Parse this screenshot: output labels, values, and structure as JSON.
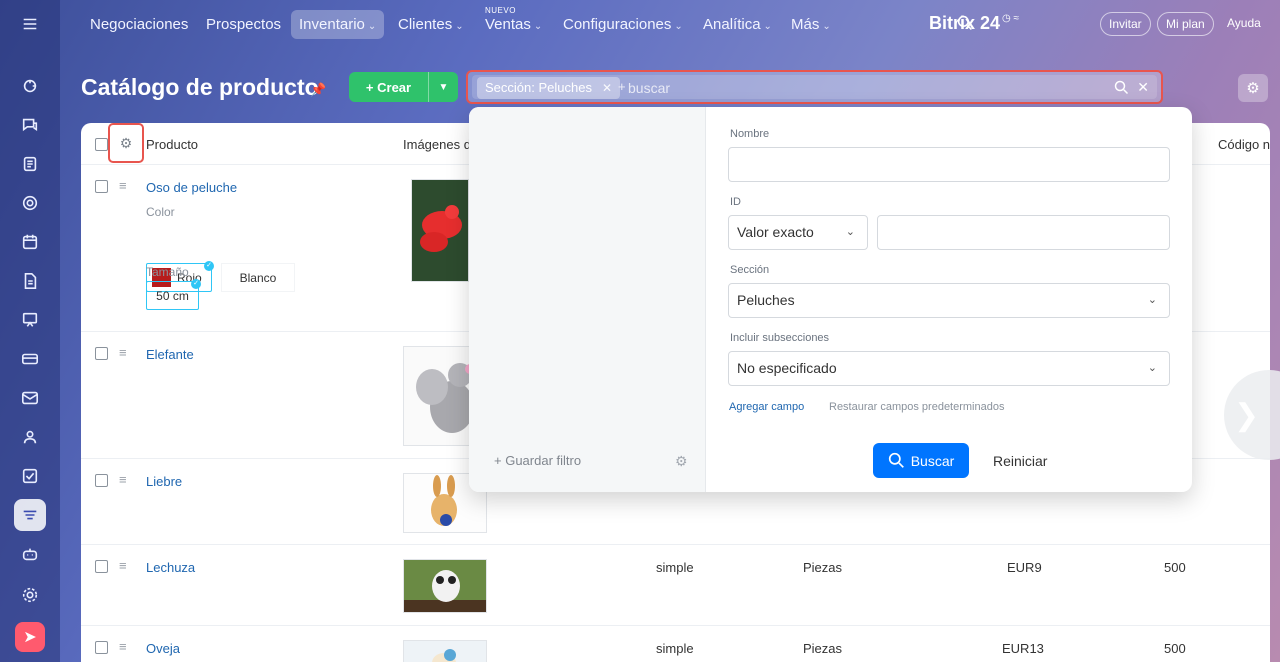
{
  "nav": {
    "items": [
      {
        "label": "Negociaciones",
        "chev": false
      },
      {
        "label": "Prospectos",
        "chev": false
      },
      {
        "label": "Inventario",
        "chev": true
      },
      {
        "label": "Clientes",
        "chev": true
      },
      {
        "label": "Ventas",
        "chev": true
      },
      {
        "label": "Configuraciones",
        "chev": true
      },
      {
        "label": "Analítica",
        "chev": true
      },
      {
        "label": "Más",
        "chev": true
      }
    ],
    "new_badge": "NUEVO",
    "brand": "Bitrix 24",
    "invite": "Invitar",
    "my_plan": "Mi plan",
    "help": "Ayuda"
  },
  "header": {
    "title": "Catálogo de producto",
    "create": "Crear"
  },
  "filter": {
    "tag": "Sección: Peluches",
    "placeholder": "buscar",
    "plus": "+"
  },
  "grid": {
    "columns": {
      "product": "Producto",
      "images": "Imágenes d",
      "code": "Código n"
    },
    "rows": [
      {
        "name": "Oso de peluche"
      },
      {
        "name": "Elefante"
      },
      {
        "name": "Liebre"
      },
      {
        "name": "Lechuza",
        "type": "simple",
        "unit": "Piezas",
        "price": "EUR9",
        "qty": "500"
      },
      {
        "name": "Oveja",
        "type": "simple",
        "unit": "Piezas",
        "price": "EUR13",
        "qty": "500"
      }
    ],
    "props": {
      "color_label": "Color",
      "color_selected": "Rojo",
      "color_other": "Blanco",
      "size_label": "Tamaño",
      "size_value": "50 cm"
    }
  },
  "popup": {
    "save_filter": "Guardar filtro",
    "name_label": "Nombre",
    "id_label": "ID",
    "id_mode": "Valor exacto",
    "section_label": "Sección",
    "section_value": "Peluches",
    "subsections_label": "Incluir subsecciones",
    "subsections_value": "No especificado",
    "add_field": "Agregar campo",
    "restore": "Restaurar campos predeterminados",
    "search_btn": "Buscar",
    "reset_btn": "Reiniciar"
  },
  "colors": {
    "accent_green": "#2fc26b",
    "accent_blue": "#0075ff",
    "highlight_red": "#e8554e",
    "link": "#2067b0"
  }
}
